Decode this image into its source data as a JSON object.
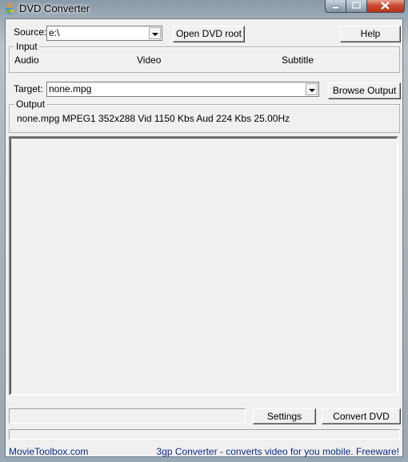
{
  "window": {
    "title": "DVD Converter",
    "controls": {
      "minimize": "minimize-icon",
      "maximize": "maximize-icon",
      "close": "close-icon"
    }
  },
  "source": {
    "label": "Source:",
    "value": "e:\\"
  },
  "buttons": {
    "open_dvd_root": "Open DVD root",
    "help": "Help",
    "browse_output": "Browse Output",
    "settings": "Settings",
    "convert_dvd": "Convert DVD"
  },
  "input_group": {
    "legend": "Input",
    "audio": "Audio",
    "video": "Video",
    "subtitle": "Subtitle"
  },
  "target": {
    "label": "Target:",
    "value": "none.mpg"
  },
  "output_group": {
    "legend": "Output",
    "info": "none.mpg MPEG1 352x288 Vid 1150 Kbs Aud 224 Kbs 25.00Hz"
  },
  "status": {
    "progress_text": "",
    "progress_fraction": 0
  },
  "footer": {
    "left_link": "MovieToolbox.com",
    "right_link": "3gp Converter - converts video for you mobile. Freeware!"
  }
}
